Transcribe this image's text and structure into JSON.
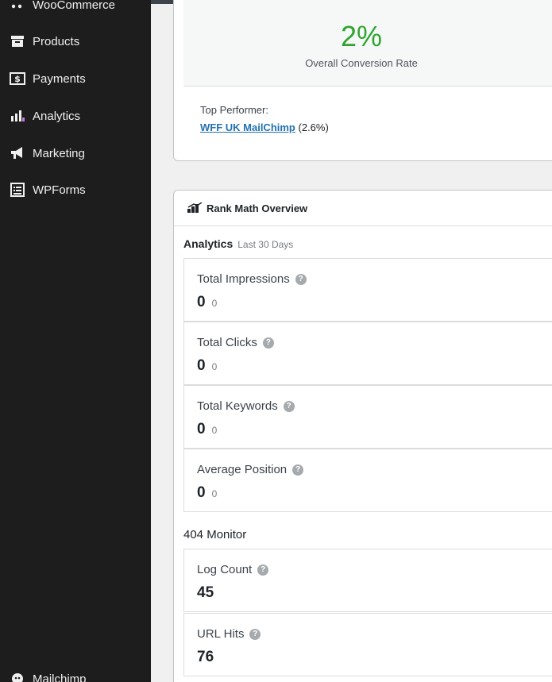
{
  "sidebar": {
    "items": [
      {
        "label": "WooCommerce",
        "icon": "woocommerce-icon"
      },
      {
        "label": "Products",
        "icon": "archive-icon"
      },
      {
        "label": "Payments",
        "icon": "payments-icon"
      },
      {
        "label": "Analytics",
        "icon": "chart-bar-icon"
      },
      {
        "label": "Marketing",
        "icon": "megaphone-icon"
      },
      {
        "label": "WPForms",
        "icon": "form-icon"
      },
      {
        "label": "Mailchimp",
        "icon": "mailchimp-icon"
      }
    ]
  },
  "conversion": {
    "value": "2%",
    "label": "Overall Conversion Rate",
    "top_performer_label": "Top Performer:",
    "top_performer_link": "WFF UK MailChimp",
    "top_performer_value": "(2.6%)",
    "value_color": "#2fa52f"
  },
  "rankmath": {
    "title": "Rank Math Overview",
    "analytics_heading": "Analytics",
    "analytics_period": "Last 30 Days",
    "metrics": [
      {
        "label": "Total Impressions",
        "value": "0",
        "diff": "0"
      },
      {
        "label": "Total Clicks",
        "value": "0",
        "diff": "0"
      },
      {
        "label": "Total Keywords",
        "value": "0",
        "diff": "0"
      },
      {
        "label": "Average Position",
        "value": "0",
        "diff": "0"
      }
    ],
    "monitor_heading": "404 Monitor",
    "monitor": [
      {
        "label": "Log Count",
        "value": "45"
      },
      {
        "label": "URL Hits",
        "value": "76"
      }
    ],
    "help_glyph": "?"
  }
}
